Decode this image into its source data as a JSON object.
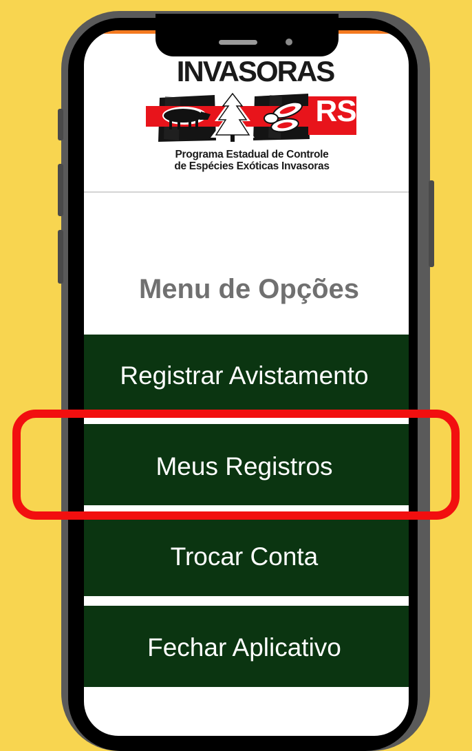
{
  "logo": {
    "title": "INVASORAS",
    "badge": "RS",
    "subtitle_line1": "Programa Estadual de Controle",
    "subtitle_line2": "de Espécies Exóticas Invasoras"
  },
  "menu": {
    "title": "Menu de Opções",
    "items": [
      {
        "label": "Registrar Avistamento"
      },
      {
        "label": "Meus Registros",
        "highlighted": true
      },
      {
        "label": "Trocar Conta"
      },
      {
        "label": "Fechar Aplicativo"
      }
    ]
  },
  "colors": {
    "background": "#f8d550",
    "menu_button": "#0b3511",
    "highlight_outline": "#f20f0f",
    "logo_red": "#e8141b",
    "menu_title": "#707070"
  }
}
